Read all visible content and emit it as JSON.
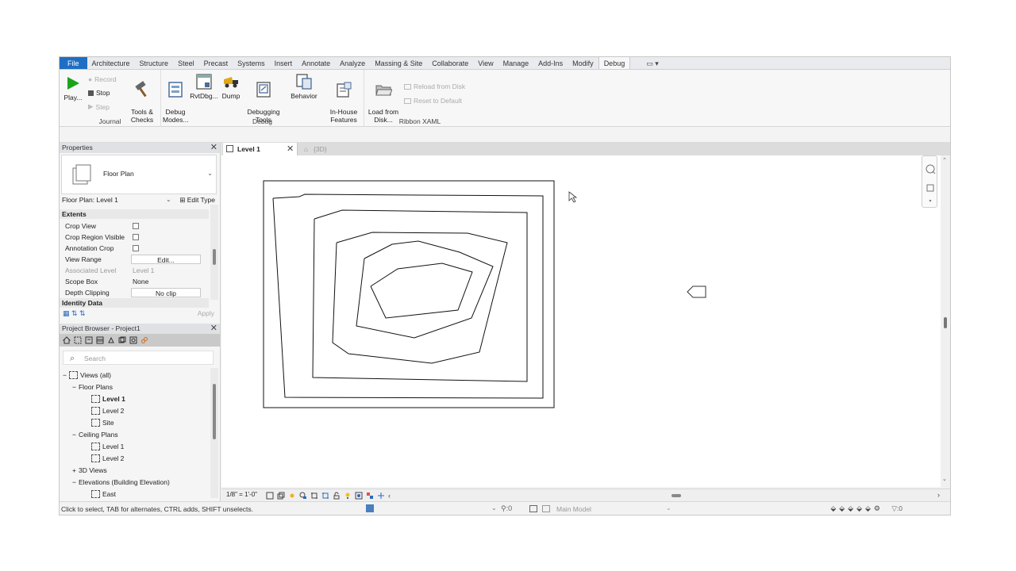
{
  "ribbon_tabs": [
    "File",
    "Architecture",
    "Structure",
    "Steel",
    "Precast",
    "Systems",
    "Insert",
    "Annotate",
    "Analyze",
    "Massing & Site",
    "Collaborate",
    "View",
    "Manage",
    "Add-Ins",
    "Modify",
    "Debug"
  ],
  "active_tab": "Debug",
  "journal": {
    "play": "Play...",
    "record": "Record",
    "stop": "Stop",
    "step": "Step",
    "group": "Journal"
  },
  "debug": {
    "tools_checks": "Tools &\nChecks",
    "debug_modes": "Debug\nModes...",
    "rvtdbg": "RvtDbg...",
    "dump": "Dump",
    "debugging_tools": "Debugging\nTools",
    "behavior": "Behavior",
    "inhouse": "In-House\nFeatures",
    "group": "Debug"
  },
  "ribbon_xaml": {
    "load_from_disk": "Load from\nDisk...",
    "reload_from_disk": "Reload from Disk",
    "reset_to_default": "Reset to Default",
    "group": "Ribbon XAML"
  },
  "properties": {
    "title": "Properties",
    "type_name": "Floor Plan",
    "filter": "Floor Plan: Level 1",
    "edit_type": "Edit Type",
    "extents_label": "Extents",
    "identity_label": "Identity Data",
    "apply": "Apply",
    "rows": [
      {
        "key": "Crop View",
        "kind": "check"
      },
      {
        "key": "Crop Region Visible",
        "kind": "check"
      },
      {
        "key": "Annotation Crop",
        "kind": "check"
      },
      {
        "key": "View Range",
        "kind": "button",
        "value": "Edit..."
      },
      {
        "key": "Associated Level",
        "kind": "text",
        "value": "Level 1",
        "dim": true
      },
      {
        "key": "Scope Box",
        "kind": "text",
        "value": "None"
      },
      {
        "key": "Depth Clipping",
        "kind": "button",
        "value": "No clip"
      }
    ]
  },
  "browser": {
    "title": "Project Browser - Project1",
    "search_placeholder": "Search",
    "views_all": "Views (all)",
    "floor_plans": "Floor Plans",
    "fp_level1": "Level 1",
    "fp_level2": "Level 2",
    "fp_site": "Site",
    "ceiling_plans": "Ceiling Plans",
    "cp_level1": "Level 1",
    "cp_level2": "Level 2",
    "views_3d": "3D Views",
    "elevations": "Elevations (Building Elevation)",
    "east": "East"
  },
  "doc_tabs": {
    "tab1": "Level 1",
    "tab2": "{3D}"
  },
  "viewbar": {
    "scale": "1/8\" = 1'-0\""
  },
  "status": {
    "hint": "Click to select, TAB for alternates, CTRL adds, SHIFT unselects.",
    "workset": ":0",
    "model": "Main Model",
    "filter_count": ":0"
  }
}
